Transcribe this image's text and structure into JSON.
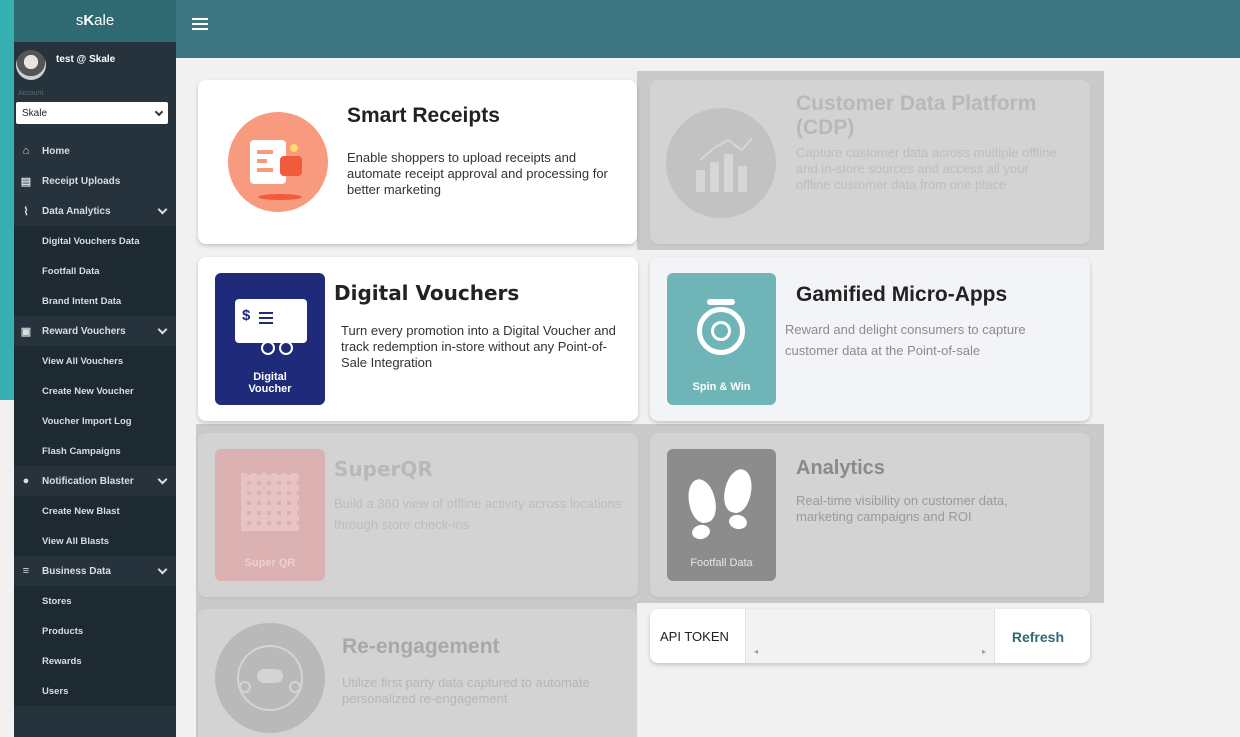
{
  "brand": {
    "prefix": "s",
    "mid": "K",
    "suffix": "ale"
  },
  "user": {
    "name": "test @ Skale"
  },
  "account": {
    "label": "Account",
    "selected": "Skale"
  },
  "nav": {
    "home": "Home",
    "receipt_uploads": "Receipt Uploads",
    "data_analytics": "Data Analytics",
    "digital_vouchers_data": "Digital Vouchers Data",
    "footfall_data": "Footfall Data",
    "brand_intent_data": "Brand Intent Data",
    "reward_vouchers": "Reward Vouchers",
    "view_all_vouchers": "View All Vouchers",
    "create_new_voucher": "Create New Voucher",
    "voucher_import_log": "Voucher Import Log",
    "flash_campaigns": "Flash Campaigns",
    "notification_blaster": "Notification Blaster",
    "create_new_blast": "Create New Blast",
    "view_all_blasts": "View All Blasts",
    "business_data": "Business Data",
    "stores": "Stores",
    "products": "Products",
    "rewards": "Rewards",
    "users": "Users"
  },
  "cards": {
    "smart_receipts": {
      "title": "Smart Receipts",
      "desc": "Enable shoppers to upload receipts and automate receipt approval and processing for better marketing"
    },
    "cdp": {
      "title": "Customer Data Platform (CDP)",
      "desc": "Capture customer data across multiple offline and in-store sources and access all your offline customer data from one place"
    },
    "digital_vouchers": {
      "title": "Digital Vouchers",
      "desc": "Turn every promotion into a Digital Voucher and track redemption in-store without any Point-of-Sale Integration",
      "tile_label": "Digital Voucher",
      "tile_line1": "Digital",
      "tile_line2": "Voucher"
    },
    "gamified": {
      "title": "Gamified Micro-Apps",
      "desc": "Reward and delight consumers to capture customer data at the Point-of-sale",
      "tile_label": "Spin & Win"
    },
    "superqr": {
      "title": "SuperQR",
      "desc": "Build a 360 view of offline activity across locations through store check-ins",
      "tile_label": "Super QR"
    },
    "analytics": {
      "title": "Analytics",
      "desc": "Real-time visibility on customer data, marketing campaigns and ROI",
      "tile_label": "Footfall Data"
    },
    "reengagement": {
      "title": "Re-engagement",
      "desc": "Utilize first party data captured to automate personalized re-engagement"
    }
  },
  "api": {
    "label": "API TOKEN",
    "refresh": "Refresh",
    "value": ""
  }
}
